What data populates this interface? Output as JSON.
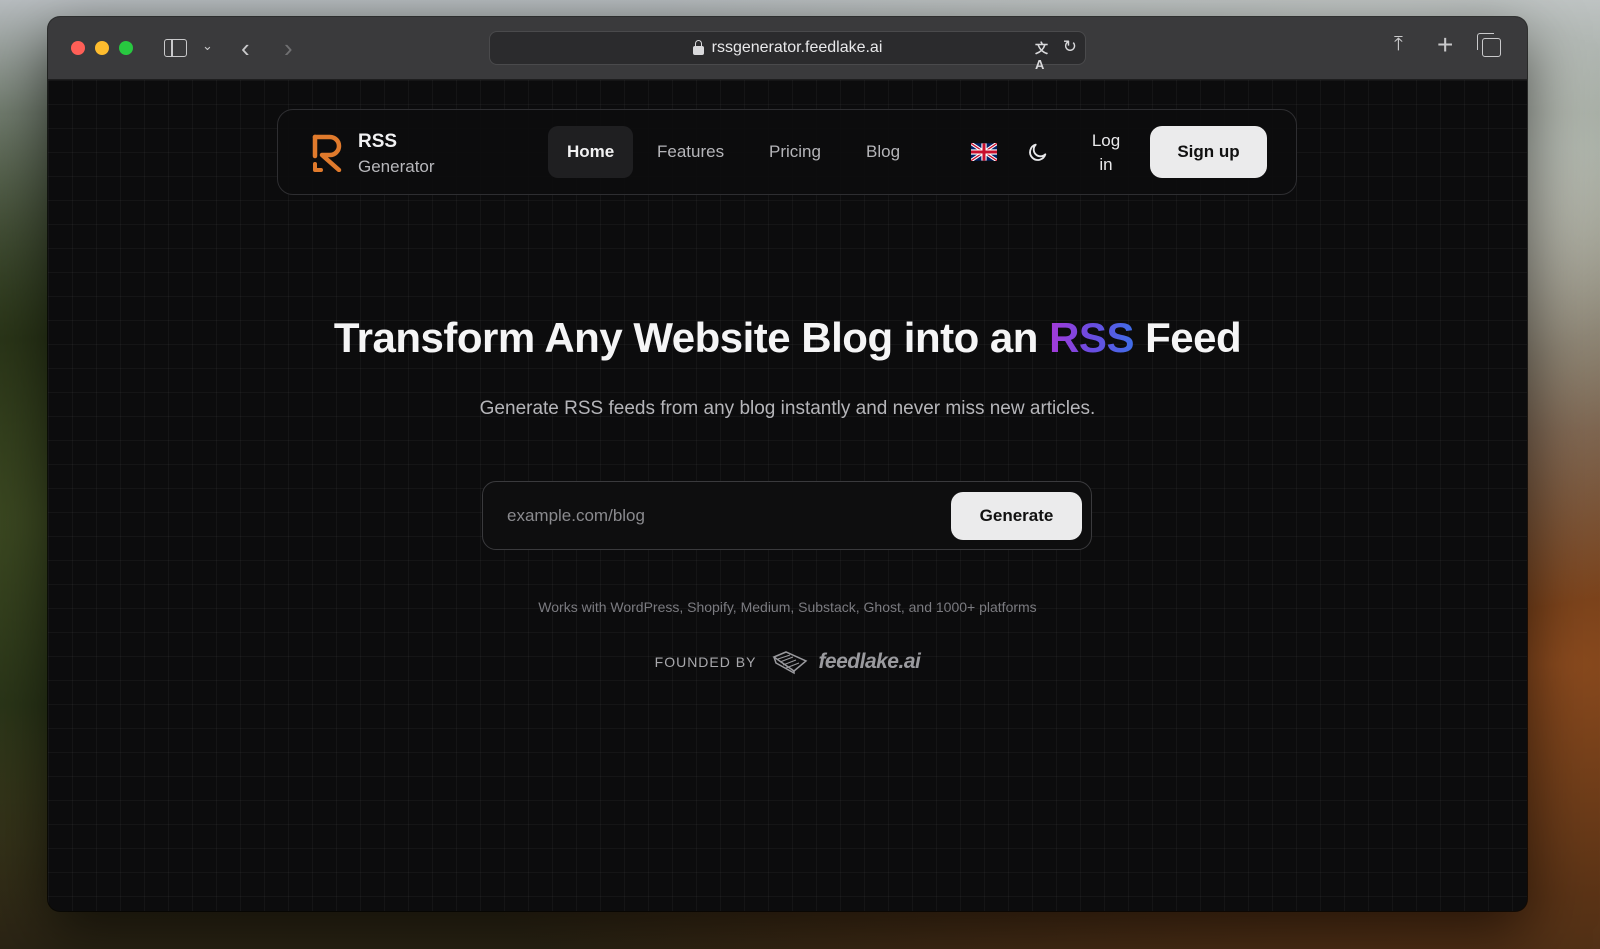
{
  "browser": {
    "url": "rssgenerator.feedlake.ai",
    "icons": [
      "sidebar-icon",
      "chevron-down-icon",
      "back-icon",
      "forward-icon",
      "lock-icon",
      "translate-icon",
      "reload-icon",
      "share-icon",
      "plus-icon",
      "tabs-icon"
    ]
  },
  "navbar": {
    "brand_line1": "RSS",
    "brand_line2": "Generator",
    "links": [
      {
        "label": "Home",
        "active": true
      },
      {
        "label": "Features",
        "active": false
      },
      {
        "label": "Pricing",
        "active": false
      },
      {
        "label": "Blog",
        "active": false
      }
    ],
    "language_icon": "uk-flag-icon",
    "theme_icon": "moon-icon",
    "login_line1": "Log",
    "login_line2": "in",
    "signup_label": "Sign up"
  },
  "hero": {
    "title_before": "Transform Any Website Blog into an ",
    "title_highlight": "RSS",
    "title_after": " Feed",
    "subtitle": "Generate RSS feeds from any blog instantly and never miss new articles.",
    "input_placeholder": "example.com/blog",
    "input_value": "",
    "generate_label": "Generate",
    "platforms_note": "Works with WordPress, Shopify, Medium, Substack, Ghost, and 1000+ platforms",
    "founded_label": "FOUNDED BY",
    "founder_brand": "feedlake.ai"
  },
  "colors": {
    "accent_gradient_start": "#a53ad9",
    "accent_gradient_end": "#3f6ee8",
    "logo_orange": "#e07a2c",
    "background": "#0c0c0d"
  }
}
